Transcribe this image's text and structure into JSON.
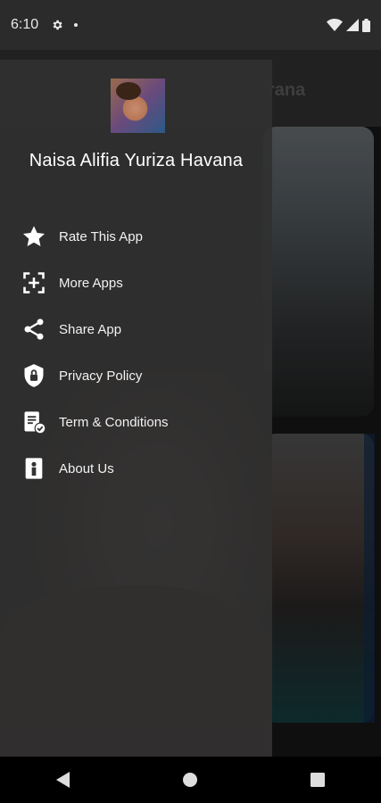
{
  "status": {
    "time": "6:10",
    "icons": [
      "gear-icon",
      "notification-dot-icon",
      "wifi-icon",
      "signal-icon",
      "battery-icon"
    ]
  },
  "background": {
    "title": "rana"
  },
  "drawer": {
    "user_name": "Naisa Alifia Yuriza Havana",
    "items": [
      {
        "label": "Rate This App",
        "icon": "star-icon"
      },
      {
        "label": "More Apps",
        "icon": "more-apps-icon"
      },
      {
        "label": "Share App",
        "icon": "share-icon"
      },
      {
        "label": "Privacy Policy",
        "icon": "shield-lock-icon"
      },
      {
        "label": "Term & Conditions",
        "icon": "document-check-icon"
      },
      {
        "label": "About Us",
        "icon": "about-icon"
      }
    ]
  },
  "nav": {
    "icons": [
      "back-icon",
      "home-icon",
      "recents-icon"
    ]
  },
  "colors": {
    "drawer_bg": "#303030",
    "status_bar": "#2b2b2b",
    "text": "#ffffff"
  }
}
